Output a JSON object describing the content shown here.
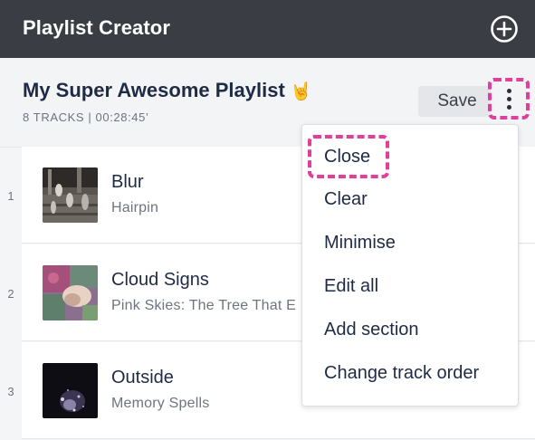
{
  "app": {
    "title": "Playlist Creator",
    "add_icon": "plus-circle-icon"
  },
  "playlist": {
    "title": "My Super Awesome Playlist",
    "emoji": "🤘",
    "meta": "8 TRACKS | 00:28:45’",
    "save_label": "Save",
    "more_icon": "vertical-dots-icon"
  },
  "tracks": [
    {
      "number": "1",
      "title": "Blur",
      "artist": "Hairpin"
    },
    {
      "number": "2",
      "title": "Cloud Signs",
      "artist": "Pink Skies: The Tree That E"
    },
    {
      "number": "3",
      "title": "Outside",
      "artist": "Memory Spells"
    }
  ],
  "menu": {
    "items": [
      "Close",
      "Clear",
      "Minimise",
      "Edit all",
      "Add section",
      "Change track order"
    ],
    "highlighted": "Close"
  },
  "colors": {
    "header_bg": "#3a3d43",
    "highlight_dash": "#e0409b",
    "text_primary": "#1f2a44",
    "text_secondary": "#6d7480"
  }
}
